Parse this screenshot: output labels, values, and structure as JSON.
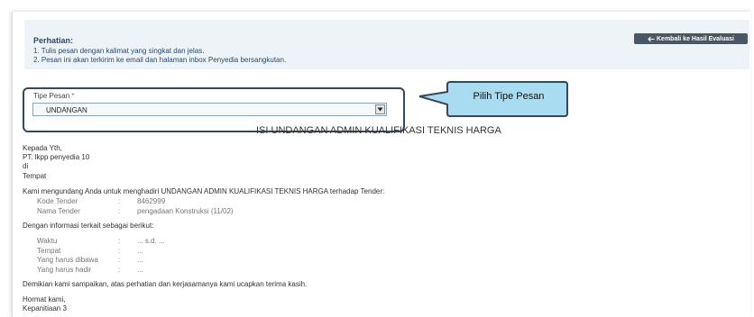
{
  "notice": {
    "title": "Perhatian:",
    "line1": "1. Tulis pesan dengan kalimat yang singkat dan jelas.",
    "line2": "2. Pesan ini akan terkirim ke email dan halaman inbox Penyedia bersangkutan.",
    "back_button": "Kembali ke Hasil Evaluasi",
    "back_icon": "arrow-left-icon"
  },
  "form": {
    "type_label": "Tipe Pesan",
    "required_marker": "*",
    "selected_value": "UNDANGAN"
  },
  "callout": {
    "text": "Pilih Tipe Pesan",
    "fill": "#a9dcf0"
  },
  "letter": {
    "title": "ISI UNDANGAN ADMIN KUALIFIKASI TEKNIS HARGA",
    "greeting": "Kepada Yth,",
    "recipient": "PT. lkpp penyedia 10",
    "di": "di",
    "place": "Tempat",
    "intro": "Kami mengundang Anda untuk menghadiri UNDANGAN ADMIN KUALIFIKASI TEKNIS HARGA terhadap Tender:",
    "tender": [
      {
        "key": "Kode Tender",
        "sep": ":",
        "value": "8462999"
      },
      {
        "key": "Nama Tender",
        "sep": ":",
        "value": "pengadaan Konstruksi (11/02)"
      }
    ],
    "info_intro": "Dengan informasi terkait sebagai berikut:",
    "details": [
      {
        "key": "Waktu",
        "sep": ":",
        "value": "... s.d. ..."
      },
      {
        "key": "Tempat",
        "sep": ":",
        "value": "..."
      },
      {
        "key": "Yang harus dibawa",
        "sep": ":",
        "value": "..."
      },
      {
        "key": "Yang harus hadir",
        "sep": ":",
        "value": "..."
      }
    ],
    "closing": "Demikian kami sampaikan, atas perhatian dan kerjasamanya kami ucapkan terima kasih.",
    "regards": "Hormat kami,",
    "signature": "Kepanitiaan 3"
  }
}
